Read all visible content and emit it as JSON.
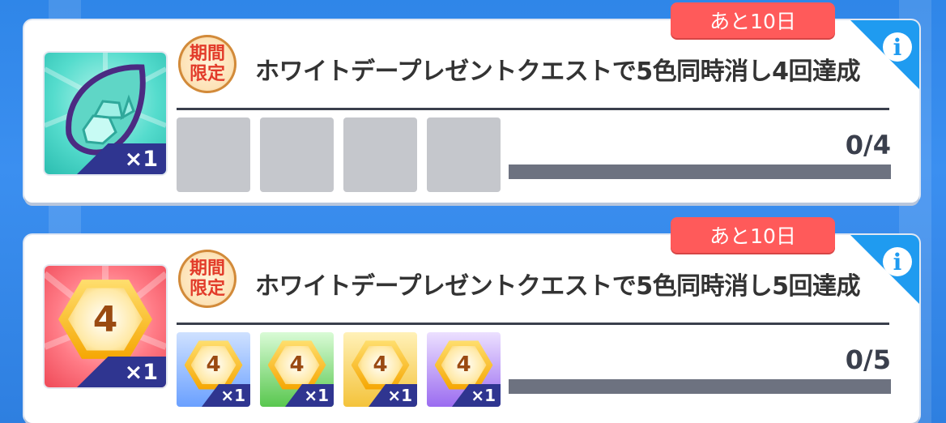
{
  "quests": [
    {
      "deadline": "あと10日",
      "badge_line1": "期間",
      "badge_line2": "限定",
      "title": "ホワイトデープレゼントクエストで5色同時消し4回達成",
      "reward_qty": "×1",
      "progress_text": "0/4",
      "progress_fraction": 0,
      "slot_count": 4
    },
    {
      "deadline": "あと10日",
      "badge_line1": "期間",
      "badge_line2": "限定",
      "title": "ホワイトデープレゼントクエストで5色同時消し5回達成",
      "reward_qty": "×1",
      "reward_number": "4",
      "progress_text": "0/5",
      "progress_fraction": 0,
      "slots": [
        {
          "number": "4",
          "qty": "×1",
          "color": "blue"
        },
        {
          "number": "4",
          "qty": "×1",
          "color": "green"
        },
        {
          "number": "4",
          "qty": "×1",
          "color": "yellow"
        },
        {
          "number": "4",
          "qty": "×1",
          "color": "purple"
        }
      ]
    }
  ],
  "info_icon_label": "i",
  "colors": {
    "deadline": "#ff5a5a",
    "info": "#1f9bf0",
    "qty_band": "#2f3590",
    "progress_track": "#6d7280"
  }
}
